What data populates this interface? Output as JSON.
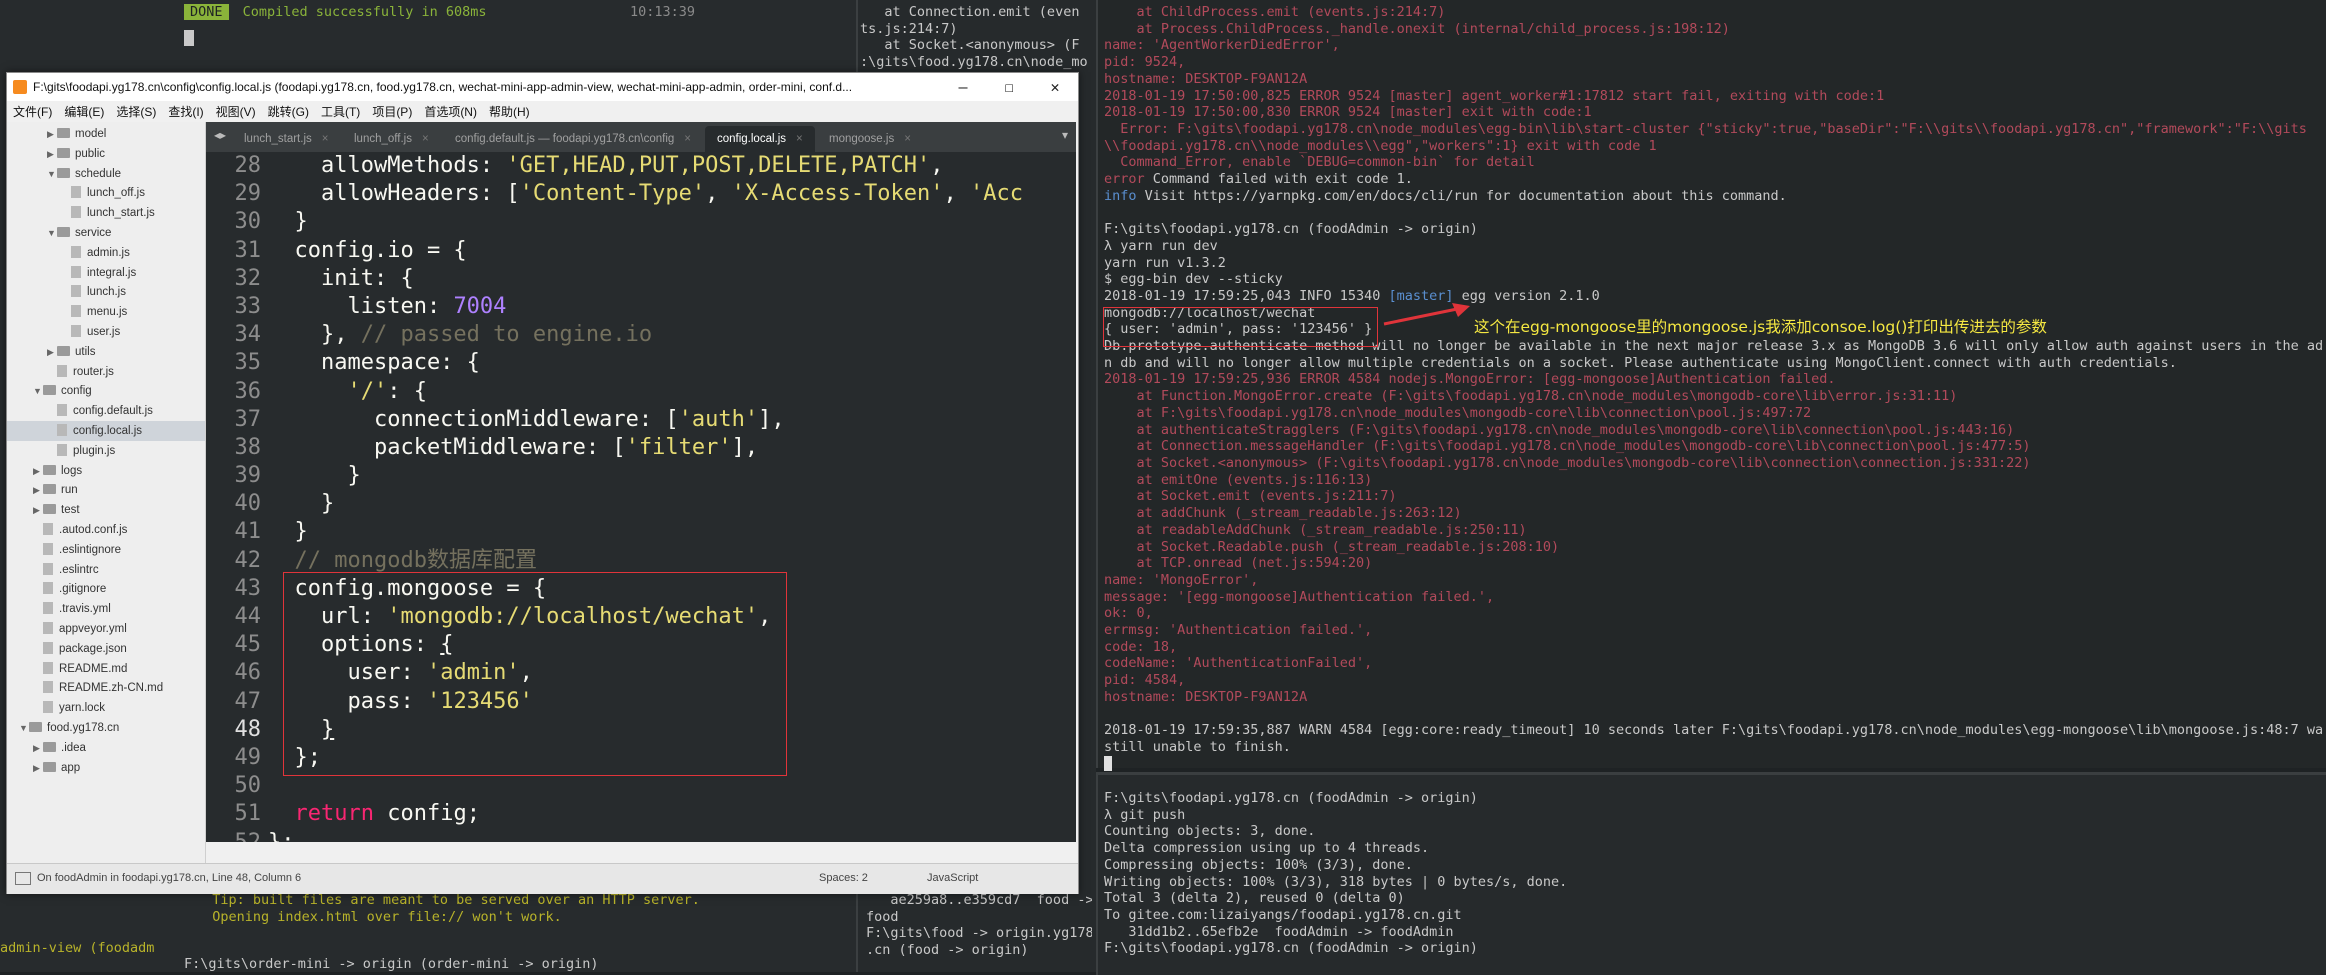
{
  "left_pane": {
    "top_lines": [
      {
        "text": "DONE  Compiled successfully in 608ms",
        "badge": "DONE",
        "msg": "Compiled successfully in 608ms"
      },
      {
        "text": "10:13:39"
      }
    ],
    "bottom_lines": [
      "  Tip: built files are meant to be served over an HTTP server.",
      "  Opening index.html over file:// won't work."
    ],
    "frag_left": "admin-view (foodadm",
    "prompt_line": "F:\\gits\\order-mini -> origin (order-mini -> origin)"
  },
  "mid_pane": {
    "top_lines": [
      "   at Connection.emit (even",
      "ts.js:214:7)",
      "   at Socket.<anonymous> (F",
      ":\\gits\\food.yg178.cn\\node_mo"
    ],
    "bottom_lines": [
      "   ae259a8..e359cd7  food ->",
      "food",
      "",
      "F:\\gits\\food -> origin.yg178",
      ".cn (food -> origin)"
    ]
  },
  "right_pane": {
    "top_err_lines": [
      "    at ChildProcess.emit (events.js:214:7)",
      "    at Process.ChildProcess._handle.onexit (internal/child_process.js:198:12)",
      "name: 'AgentWorkerDiedError',",
      "pid: 9524,",
      "hostname: DESKTOP-F9AN12A",
      "",
      "2018-01-19 17:50:00,825 ERROR 9524 [master] agent_worker#1:17812 start fail, exiting with code:1",
      "2018-01-19 17:50:00,830 ERROR 9524 [master] exit with code:1",
      "  Error: F:\\gits\\foodapi.yg178.cn\\node_modules\\egg-bin\\lib\\start-cluster {\"sticky\":true,\"baseDir\":\"F:\\\\gits\\\\foodapi.yg178.cn\",\"framework\":\"F:\\\\gits",
      "\\\\foodapi.yg178.cn\\\\node_modules\\\\egg\",\"workers\":1} exit with code 1",
      "  Command_Error, enable `DEBUG=common-bin` for detail"
    ],
    "cmd_failed": "error Command failed with exit code 1.",
    "info_visit": "info Visit https://yarnpkg.com/en/docs/cli/run for documentation about this command.",
    "prompt1": "F:\\gits\\foodapi.yg178.cn (foodAdmin -> origin)",
    "cmd_lines": [
      "λ yarn run dev",
      "yarn run v1.3.2",
      "$ egg-bin dev --sticky",
      "2018-01-19 17:59:25,043 INFO 15340 [master] egg version 2.1.0",
      "mongodb://localhost/wechat",
      "{ user: 'admin', pass: '123456' }",
      "Db.prototype.authenticate method will no longer be available in the next major release 3.x as MongoDB 3.6 will only allow auth against users in the admi",
      "n db and will no longer allow multiple credentials on a socket. Please authenticate using MongoClient.connect with auth credentials."
    ],
    "mongo_err_lines": [
      "2018-01-19 17:59:25,936 ERROR 4584 nodejs.MongoError: [egg-mongoose]Authentication failed.",
      "    at Function.MongoError.create (F:\\gits\\foodapi.yg178.cn\\node_modules\\mongodb-core\\lib\\error.js:31:11)",
      "    at F:\\gits\\foodapi.yg178.cn\\node_modules\\mongodb-core\\lib\\connection\\pool.js:497:72",
      "    at authenticateStragglers (F:\\gits\\foodapi.yg178.cn\\node_modules\\mongodb-core\\lib\\connection\\pool.js:443:16)",
      "    at Connection.messageHandler (F:\\gits\\foodapi.yg178.cn\\node_modules\\mongodb-core\\lib\\connection\\pool.js:477:5)",
      "    at Socket.<anonymous> (F:\\gits\\foodapi.yg178.cn\\node_modules\\mongodb-core\\lib\\connection\\connection.js:331:22)",
      "    at emitOne (events.js:116:13)",
      "    at Socket.emit (events.js:211:7)",
      "    at addChunk (_stream_readable.js:263:12)",
      "    at readableAddChunk (_stream_readable.js:250:11)",
      "    at Socket.Readable.push (_stream_readable.js:208:10)",
      "    at TCP.onread (net.js:594:20)",
      "name: 'MongoError',",
      "message: '[egg-mongoose]Authentication failed.',",
      "ok: 0,",
      "errmsg: 'Authentication failed.',",
      "code: 18,",
      "codeName: 'AuthenticationFailed',",
      "pid: 4584,",
      "hostname: DESKTOP-F9AN12A"
    ],
    "warn_lines": [
      "2018-01-19 17:59:35,887 WARN 4584 [egg:core:ready_timeout] 10 seconds later F:\\gits\\foodapi.yg178.cn\\node_modules\\egg-mongoose\\lib\\mongoose.js:48:7 was",
      "still unable to finish."
    ],
    "bottom_lines": [
      "F:\\gits\\foodapi.yg178.cn (foodAdmin -> origin)",
      "λ git push",
      "Counting objects: 3, done.",
      "Delta compression using up to 4 threads.",
      "Compressing objects: 100% (3/3), done.",
      "Writing objects: 100% (3/3), 318 bytes | 0 bytes/s, done.",
      "Total 3 (delta 2), reused 0 (delta 0)",
      "To gitee.com:lizaiyangs/foodapi.yg178.cn.git",
      "   31dd1b2..65efb2e  foodAdmin -> foodAdmin",
      "",
      "F:\\gits\\foodapi.yg178.cn (foodAdmin -> origin)"
    ],
    "annotation": "这个在egg-mongoose里的mongoose.js我添加consoe.log()打印出传进去的参数"
  },
  "editor": {
    "title": "F:\\gits\\foodapi.yg178.cn\\config\\config.local.js (foodapi.yg178.cn, food.yg178.cn, wechat-mini-app-admin-view, wechat-mini-app-admin, order-mini, conf.d...",
    "window_buttons": {
      "min": "—",
      "max": "☐",
      "close": "✕"
    },
    "menu": [
      "文件(F)",
      "编辑(E)",
      "选择(S)",
      "查找(I)",
      "视图(V)",
      "跳转(G)",
      "工具(T)",
      "项目(P)",
      "首选项(N)",
      "帮助(H)"
    ],
    "tabs": [
      "lunch_start.js",
      "lunch_off.js",
      "config.default.js — foodapi.yg178.cn\\config",
      "config.local.js",
      "mongoose.js"
    ],
    "active_tab": 3,
    "sidebar": [
      {
        "label": "model",
        "type": "folder",
        "depth": 2,
        "open": false
      },
      {
        "label": "public",
        "type": "folder",
        "depth": 2,
        "open": false
      },
      {
        "label": "schedule",
        "type": "folder",
        "depth": 2,
        "open": true
      },
      {
        "label": "lunch_off.js",
        "type": "file",
        "depth": 3
      },
      {
        "label": "lunch_start.js",
        "type": "file",
        "depth": 3
      },
      {
        "label": "service",
        "type": "folder",
        "depth": 2,
        "open": true
      },
      {
        "label": "admin.js",
        "type": "file",
        "depth": 3
      },
      {
        "label": "integral.js",
        "type": "file",
        "depth": 3
      },
      {
        "label": "lunch.js",
        "type": "file",
        "depth": 3
      },
      {
        "label": "menu.js",
        "type": "file",
        "depth": 3
      },
      {
        "label": "user.js",
        "type": "file",
        "depth": 3
      },
      {
        "label": "utils",
        "type": "folder",
        "depth": 2,
        "open": false
      },
      {
        "label": "router.js",
        "type": "file",
        "depth": 2
      },
      {
        "label": "config",
        "type": "folder",
        "depth": 1,
        "open": true
      },
      {
        "label": "config.default.js",
        "type": "file",
        "depth": 2
      },
      {
        "label": "config.local.js",
        "type": "file",
        "depth": 2,
        "selected": true
      },
      {
        "label": "plugin.js",
        "type": "file",
        "depth": 2
      },
      {
        "label": "logs",
        "type": "folder",
        "depth": 1,
        "open": false
      },
      {
        "label": "run",
        "type": "folder",
        "depth": 1,
        "open": false
      },
      {
        "label": "test",
        "type": "folder",
        "depth": 1,
        "open": false
      },
      {
        "label": ".autod.conf.js",
        "type": "file",
        "depth": 1
      },
      {
        "label": ".eslintignore",
        "type": "file",
        "depth": 1
      },
      {
        "label": ".eslintrc",
        "type": "file",
        "depth": 1
      },
      {
        "label": ".gitignore",
        "type": "file",
        "depth": 1
      },
      {
        "label": ".travis.yml",
        "type": "file",
        "depth": 1
      },
      {
        "label": "appveyor.yml",
        "type": "file",
        "depth": 1
      },
      {
        "label": "package.json",
        "type": "file",
        "depth": 1
      },
      {
        "label": "README.md",
        "type": "file",
        "depth": 1
      },
      {
        "label": "README.zh-CN.md",
        "type": "file",
        "depth": 1
      },
      {
        "label": "yarn.lock",
        "type": "file",
        "depth": 1
      },
      {
        "label": "food.yg178.cn",
        "type": "folder",
        "depth": 0,
        "open": true
      },
      {
        "label": ".idea",
        "type": "folder",
        "depth": 1,
        "open": false
      },
      {
        "label": "app",
        "type": "folder",
        "depth": 1,
        "open": false
      }
    ],
    "code_lines": [
      {
        "n": "28",
        "html": "    allowMethods: <span class=\"str\">'GET,HEAD,PUT,POST,DELETE,PATCH'</span>,"
      },
      {
        "n": "29",
        "html": "    allowHeaders: [<span class=\"str\">'Content-Type'</span>, <span class=\"str\">'X-Access-Token'</span>, <span class=\"str\">'Acc</span>"
      },
      {
        "n": "30",
        "html": "  }"
      },
      {
        "n": "31",
        "html": "  config.io = {"
      },
      {
        "n": "32",
        "html": "    init: {"
      },
      {
        "n": "33",
        "html": "      listen: <span class=\"num\">7004</span>"
      },
      {
        "n": "34",
        "html": "    }, <span class=\"cm\">// passed to engine.io</span>"
      },
      {
        "n": "35",
        "html": "    namespace: {"
      },
      {
        "n": "36",
        "html": "      <span class=\"str\">'/'</span>: {"
      },
      {
        "n": "37",
        "html": "        connectionMiddleware: [<span class=\"str\">'auth'</span>],"
      },
      {
        "n": "38",
        "html": "        packetMiddleware: [<span class=\"str\">'filter'</span>],"
      },
      {
        "n": "39",
        "html": "      }"
      },
      {
        "n": "40",
        "html": "    }"
      },
      {
        "n": "41",
        "html": "  }"
      },
      {
        "n": "42",
        "html": "  <span class=\"cm\">// mongodb数据库配置</span>"
      },
      {
        "n": "43",
        "html": "  config.mongoose = {"
      },
      {
        "n": "44",
        "html": "    url: <span class=\"str\">'mongodb://localhost/wechat'</span>,"
      },
      {
        "n": "45",
        "html": "    options: <u>{</u>",
        "gutter": "<"
      },
      {
        "n": "46",
        "html": "      user: <span class=\"str\">'admin'</span>,"
      },
      {
        "n": "47",
        "html": "      pass: <span class=\"str\">'123456'</span>"
      },
      {
        "n": "48",
        "html": "    <u>}</u>",
        "current": true
      },
      {
        "n": "49",
        "html": "  };"
      },
      {
        "n": "50",
        "html": ""
      },
      {
        "n": "51",
        "html": "  <span class=\"kw\">return</span> config;"
      },
      {
        "n": "52",
        "html": "};"
      }
    ],
    "status_left": "On foodAdmin in foodapi.yg178.cn, Line 48, Column 6",
    "status_spaces": "Spaces: 2",
    "status_syntax": "JavaScript"
  }
}
